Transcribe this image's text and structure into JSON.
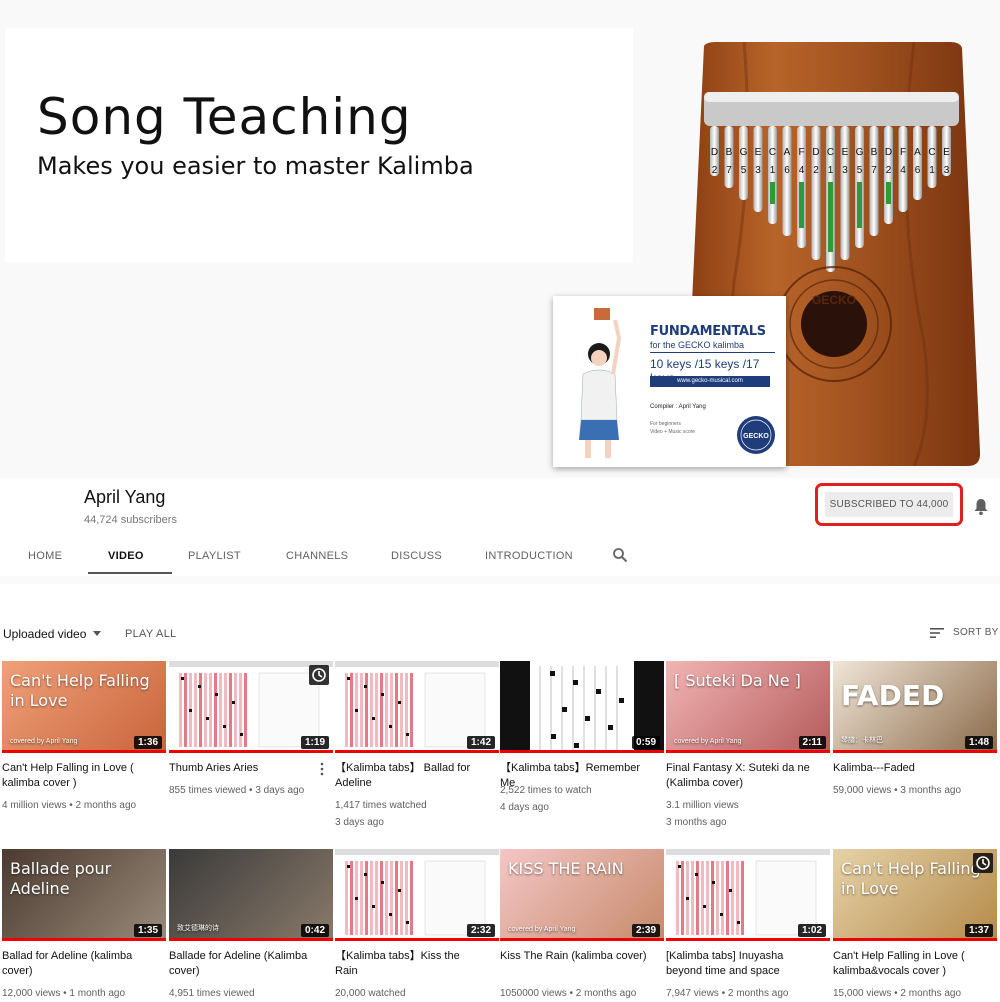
{
  "banner": {
    "title": "Song Teaching",
    "subtitle": "Makes you easier to master Kalimba",
    "kalimba_notes": [
      "D",
      "B",
      "G",
      "E",
      "C",
      "A",
      "F",
      "D",
      "C",
      "E",
      "G",
      "B",
      "D",
      "F",
      "A",
      "C",
      "E"
    ],
    "kalimba_numbers": [
      "2",
      "7",
      "5",
      "3",
      "1",
      "6",
      "4",
      "2",
      "1",
      "3",
      "5",
      "7",
      "2",
      "4",
      "6",
      "1",
      "3"
    ],
    "kalimba_logo": "GECKO",
    "booklet": {
      "title": "FUNDAMENTALS",
      "subtitle": "for the GECKO kalimba",
      "keys": "10 keys /15 keys /17 keys",
      "url": "www.gecko-musical.com",
      "compiler": "Compiler : April Yang",
      "small_1": "For beginners",
      "small_2": "Video + Music score",
      "logo": "GECKO"
    }
  },
  "channel": {
    "name": "April Yang",
    "subscribers": "44,724 subscribers",
    "subscribe_label": "SUBSCRIBED TO  44,000"
  },
  "tabs": [
    {
      "label": "HOME"
    },
    {
      "label": "VIDEO"
    },
    {
      "label": "PLAYLIST"
    },
    {
      "label": "CHANNELS"
    },
    {
      "label": "DISCUSS"
    },
    {
      "label": "INTRODUCTION"
    }
  ],
  "toolbar": {
    "uploaded": "Uploaded video",
    "play_all": "PLAY ALL",
    "sort_by": "SORT BY"
  },
  "videos": [
    {
      "title": "Can't Help Falling in Love ( kalimba cover )",
      "meta1": "4 million views  • 2 months ago",
      "meta2": "",
      "duration": "1:36",
      "thumb_text": "Can't Help Falling in Love",
      "thumb_caption": "covered by April Yang"
    },
    {
      "title": "Thumb Aries Aries",
      "meta1": "855 times viewed  • 3 days ago",
      "meta2": "",
      "duration": "1:19"
    },
    {
      "title": "【Kalimba tabs】 Ballad for Adeline",
      "meta1": "1,417 times watched",
      "meta2": "3 days ago",
      "duration": "1:42"
    },
    {
      "title": "【Kalimba tabs】Remember Me",
      "meta1": "2,522 times to watch",
      "meta2": "4 days ago",
      "duration": "0:59"
    },
    {
      "title": "Final Fantasy X: Suteki da ne (Kalimba cover)",
      "meta1": "3.1 million views",
      "meta2": "3 months ago",
      "duration": "2:11",
      "thumb_text": "[ Suteki Da Ne ]",
      "thumb_caption": "covered by April Yang"
    },
    {
      "title": "Kalimba---Faded",
      "meta1": "59,000 views  • 3 months ago",
      "meta2": "",
      "duration": "1:48",
      "thumb_text": "FADED",
      "thumb_caption": "琴譜：卡林巴"
    },
    {
      "title": "Ballad for Adeline (kalimba cover)",
      "meta1": "12,000 views  • 1 month ago",
      "meta2": "",
      "duration": "1:35",
      "thumb_text": "Ballade pour Adeline"
    },
    {
      "title": "Ballade for Adeline (Kalimba cover)",
      "meta1": "4,951 times viewed",
      "meta2": "",
      "duration": "0:42",
      "thumb_caption": "致艾德琳的诗"
    },
    {
      "title": "【Kalimba tabs】Kiss the Rain",
      "meta1": "20,000 watched",
      "meta2": "",
      "duration": "2:32"
    },
    {
      "title": "Kiss The Rain (kalimba cover)",
      "meta1": "1050000 views  • 2 months ago",
      "meta2": "",
      "duration": "2:39",
      "thumb_text": "KISS THE RAIN",
      "thumb_caption": "covered by April Yang"
    },
    {
      "title": "[Kalimba tabs] Inuyasha beyond time and space",
      "meta1": "7,947 views  • 2 months ago",
      "meta2": "",
      "duration": "1:02"
    },
    {
      "title": "Can't Help Falling in Love ( kalimba&vocals cover )",
      "meta1": "15,000 views  • 2 months ago",
      "meta2": "",
      "duration": "1:37",
      "thumb_text": "Can't Help Falling in Love"
    }
  ],
  "colors": {
    "accent_red": "#e0201e",
    "progress_red": "#ee0000"
  }
}
